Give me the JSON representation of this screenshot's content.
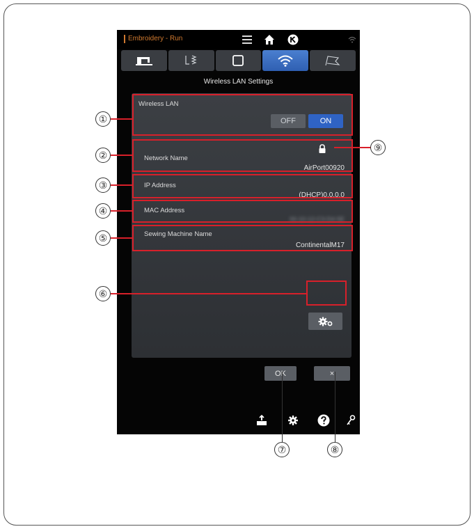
{
  "header": {
    "mode_label": "Embroidery - Run"
  },
  "tabs": [
    {
      "icon": "sewing-machine-icon"
    },
    {
      "icon": "stitch-pattern-icon"
    },
    {
      "icon": "hoop-icon"
    },
    {
      "icon": "wifi-icon",
      "active": true
    },
    {
      "icon": "flag-icon"
    }
  ],
  "screen_title": "Wireless LAN Settings",
  "wireless_lan": {
    "label": "Wireless LAN",
    "off_label": "OFF",
    "on_label": "ON",
    "selected": "ON"
  },
  "network": {
    "label": "Network Name",
    "value": "AirPort00920"
  },
  "ip": {
    "label": "IP Address",
    "value": "(DHCP)0.0.0.0"
  },
  "mac": {
    "label": "MAC Address",
    "value": "00-10-12-C3-D4-5E"
  },
  "machine": {
    "label": "Sewing Machine Name",
    "value": "ContinentalM17"
  },
  "buttons": {
    "ok": "OK",
    "cancel": "×"
  },
  "callouts": [
    "①",
    "②",
    "③",
    "④",
    "⑤",
    "⑥",
    "⑦",
    "⑧",
    "⑨"
  ],
  "colors": {
    "accent": "#2f63c4",
    "annotation": "#d8202a",
    "mode_text": "#d07a30"
  }
}
